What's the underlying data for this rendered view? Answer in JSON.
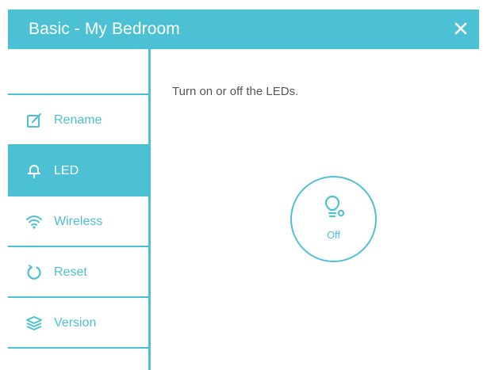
{
  "window": {
    "title": "Basic - My Bedroom"
  },
  "sidebar": {
    "items": [
      {
        "label": "Rename",
        "icon": "edit-icon",
        "active": false
      },
      {
        "label": "LED",
        "icon": "bulb-icon",
        "active": true
      },
      {
        "label": "Wireless",
        "icon": "wifi-icon",
        "active": false
      },
      {
        "label": "Reset",
        "icon": "reset-icon",
        "active": false
      },
      {
        "label": "Version",
        "icon": "stack-icon",
        "active": false
      }
    ]
  },
  "main": {
    "description": "Turn on or off the LEDs.",
    "led_toggle": {
      "state": "Off"
    }
  },
  "colors": {
    "accent": "#4cc1d3",
    "text": "#555555",
    "background": "#ffffff"
  }
}
